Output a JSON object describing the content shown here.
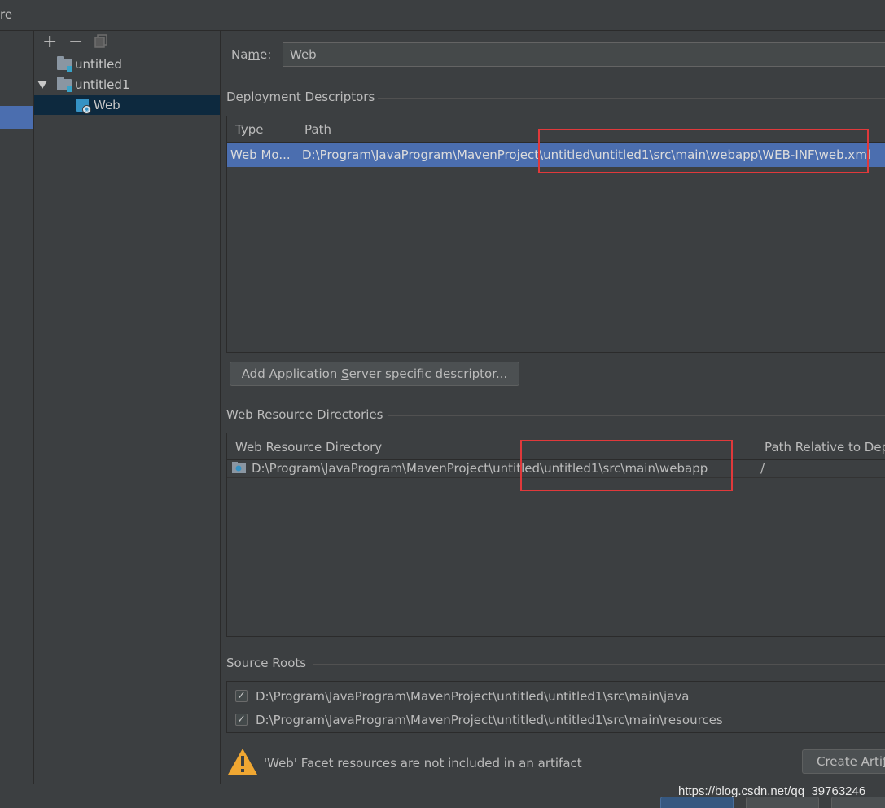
{
  "window": {
    "title_fragment": "re"
  },
  "toolbar": {
    "add": "+",
    "remove": "−"
  },
  "tree": {
    "items": [
      {
        "label": "untitled"
      },
      {
        "label": "untitled1",
        "expanded": true
      },
      {
        "label": "Web",
        "selected": true
      }
    ]
  },
  "name_field": {
    "label_pre": "Na",
    "label_u": "m",
    "label_post": "e:",
    "value": "Web"
  },
  "deployment": {
    "title": "Deployment Descriptors",
    "columns": [
      "Type",
      "Path"
    ],
    "rows": [
      {
        "type": "Web Mo...",
        "path": "D:\\Program\\JavaProgram\\MavenProject\\untitled\\untitled1\\src\\main\\webapp\\WEB-INF\\web.xml"
      }
    ],
    "add_button": {
      "pre": "Add Application ",
      "u": "S",
      "post": "erver specific descriptor..."
    }
  },
  "web_resources": {
    "title": "Web Resource Directories",
    "columns": [
      "Web Resource Directory",
      "Path Relative to Dep"
    ],
    "rows": [
      {
        "directory": "D:\\Program\\JavaProgram\\MavenProject\\untitled\\untitled1\\src\\main\\webapp",
        "relative": "/"
      }
    ]
  },
  "source_roots": {
    "title": "Source Roots",
    "items": [
      {
        "path": "D:\\Program\\JavaProgram\\MavenProject\\untitled\\untitled1\\src\\main\\java",
        "checked": true
      },
      {
        "path": "D:\\Program\\JavaProgram\\MavenProject\\untitled\\untitled1\\src\\main\\resources",
        "checked": true
      }
    ]
  },
  "warning": {
    "text": "'Web' Facet resources are not included in an artifact",
    "button_pre": "Create Arti",
    "button_u": "f"
  },
  "footer": {
    "watermark": "https://blog.csdn.net/qq_39763246"
  },
  "colors": {
    "accent": "#4b6eaf",
    "highlight": "#e0393b",
    "warning": "#f0a732"
  }
}
